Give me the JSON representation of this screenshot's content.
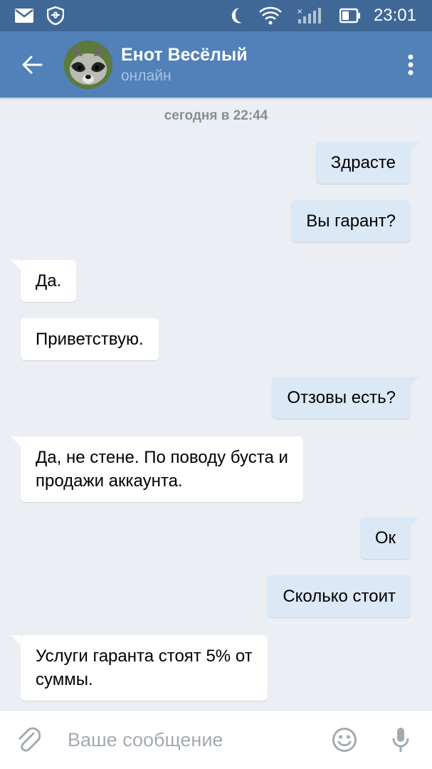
{
  "status_bar": {
    "time": "23:01",
    "icons": [
      "mail-icon",
      "shield-icon",
      "moon-icon",
      "wifi-icon",
      "signal-icon",
      "battery-icon"
    ]
  },
  "header": {
    "name": "Енот Весёлый",
    "status": "онлайн"
  },
  "chat": {
    "date_separator": "сегодня в 22:44",
    "messages": [
      {
        "dir": "out",
        "text": "Здрасте"
      },
      {
        "dir": "out",
        "text": "Вы гарант?"
      },
      {
        "dir": "in",
        "text": "Да."
      },
      {
        "dir": "in",
        "text": "Приветствую."
      },
      {
        "dir": "out",
        "text": "Отзовы есть?"
      },
      {
        "dir": "in",
        "text": "Да, не стене. По поводу буста и\nпродажи аккаунта."
      },
      {
        "dir": "out",
        "text": "Ок"
      },
      {
        "dir": "out",
        "text": "Сколько стоит"
      },
      {
        "dir": "in",
        "text": "Услуги гаранта стоят 5% от\nсуммы."
      }
    ]
  },
  "composer": {
    "placeholder": "Ваше сообщение"
  },
  "colors": {
    "status_bar": "#3f6896",
    "header": "#5181b8",
    "chat_bg": "#ebeff3",
    "outgoing_bubble": "#dbe8f5",
    "incoming_bubble": "#ffffff",
    "icon_gray": "#a4aab2"
  }
}
